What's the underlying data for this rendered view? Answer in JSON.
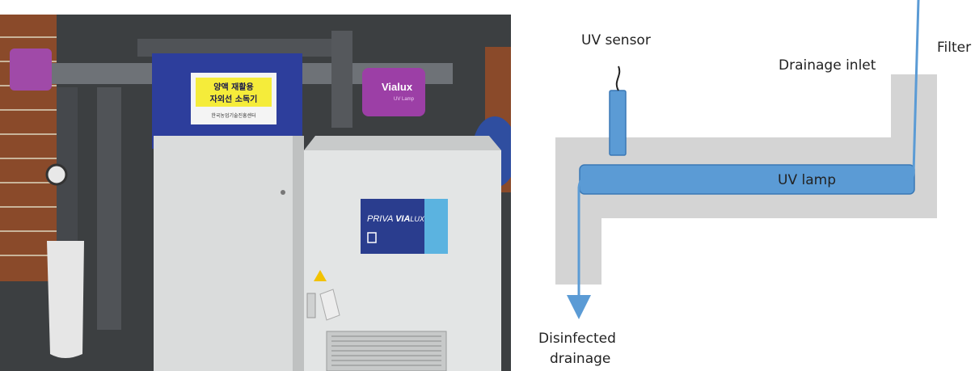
{
  "photo": {
    "panel_sign": [
      "양액 재활용",
      "자외선 소독기"
    ],
    "panel_sign_small": "한국농업기술진흥센터",
    "brand_lamp": "Vialux",
    "brand_lamp_sub": "UV Lamp",
    "cabinet_brand_a": "PRIVA ",
    "cabinet_brand_b": "VIA",
    "cabinet_brand_c": "LUX"
  },
  "diagram": {
    "uv_sensor_label": "UV sensor",
    "drainage_inlet_label": "Drainage inlet",
    "filter_label": "Filter",
    "uv_lamp_label": "UV lamp",
    "output_label_line1": "Disinfected",
    "output_label_line2": "drainage",
    "colors": {
      "pipe_gray": "#d4d4d4",
      "lamp_blue": "#5b9bd5",
      "lamp_border": "#3a78b5",
      "flow_line": "#5b9bd5"
    }
  }
}
